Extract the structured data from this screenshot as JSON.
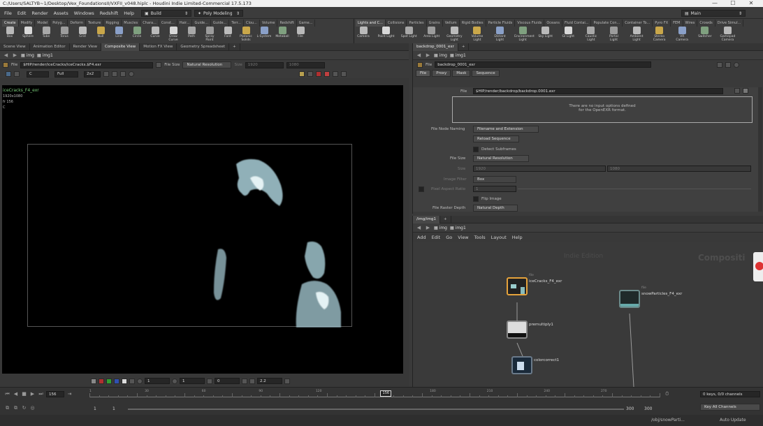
{
  "window": {
    "title": "C:/Users/SALTYB~1/Desktop/Vex_FoundationsII/VXFII_v048.hiplc - Houdini Indie Limited-Commercial 17.5.173",
    "minimize": "—",
    "maximize": "☐",
    "close": "✕"
  },
  "menubar": {
    "items": [
      "File",
      "Edit",
      "Render",
      "Assets",
      "Windows",
      "Redshift",
      "Help"
    ],
    "build_label": "Build",
    "desktop_label": "Poly Modeling",
    "main_label": "Main"
  },
  "shelf_left": {
    "tabs": [
      "Create",
      "Modify",
      "Model",
      "Polyg...",
      "Deform",
      "Texture",
      "Rigging",
      "Muscles",
      "Chara...",
      "Const...",
      "Hair...",
      "Guide...",
      "Guide...",
      "Terr...",
      "Clou...",
      "Volume",
      "Redshift",
      "Game..."
    ],
    "tools": [
      "Box",
      "Sphere",
      "Tube",
      "Torus",
      "Grid",
      "Null",
      "Line",
      "Circle",
      "Curve",
      "Draw Curve",
      "Path",
      "Spray Paint",
      "Font",
      "Platonic Solids",
      "L-System",
      "Metaball",
      "File"
    ]
  },
  "shelf_right": {
    "tabs": [
      "Lights and C...",
      "Collisions",
      "Particles",
      "Grains",
      "Vellum",
      "Rigid Bodies",
      "Particle Fluids",
      "Viscous Fluids",
      "Oceans",
      "Fluid Contai...",
      "Populate Con...",
      "Container To...",
      "Pyro FX",
      "FEM",
      "Wires",
      "Crowds",
      "Drive Simul..."
    ],
    "tools": [
      "Camera",
      "Point Light",
      "Spot Light",
      "Area Light",
      "Geometry Light",
      "Volume Light",
      "Distant Light",
      "Environment Light",
      "Sky Light",
      "GI Light",
      "Caustic Light",
      "Portal Light",
      "Ambient Light",
      "Stereo Camera",
      "VR Camera",
      "Switcher",
      "Gamepad Camera"
    ]
  },
  "left_pane": {
    "tabs": [
      "Scene View",
      "Animation Editor",
      "Render View",
      "Composite View",
      "Motion FX View",
      "Geometry Spreadsheet"
    ],
    "path": [
      "img",
      "img1"
    ],
    "file_label": "File",
    "file_path": "$HIP/render/iceCracks/iceCracks.$F4.exr",
    "filesize_label": "File Size",
    "filesize_value": "Natural Resolution",
    "size_label": "Size",
    "size_w": "1920",
    "size_h": "1080",
    "channel": "C",
    "res": "Full",
    "zoom_ratio": "2x2",
    "overlay_name": "iceCracks_F4_exr",
    "overlay_res": "1920x1080",
    "overlay_frame": "fr 156",
    "overlay_c": "C",
    "bottom_a": "1",
    "bottom_b": "1",
    "bottom_c": "0",
    "gamma": "2.2"
  },
  "param_pane": {
    "tab": "backdrop_0001_exr",
    "path": [
      "img",
      "img1"
    ],
    "node_type": "File",
    "node_name": "backdrop_0001_exr",
    "subtabs": [
      "File",
      "Proxy",
      "Mask",
      "Sequence"
    ],
    "file_label": "File",
    "file_value": "$HIP/render/backdrop/backdrop.0001.exr",
    "info_line1": "There are no input options defined",
    "info_line2": "for the OpenEXR format.",
    "naming_label": "File Node Naming",
    "naming_value": "Filename and Extension",
    "reload_label": "Reload Sequence",
    "subframes_label": "Detect Subframes",
    "filesize_label": "File Size",
    "filesize_value": "Natural Resolution",
    "size_label": "Size",
    "size_w": "1920",
    "size_h": "1080",
    "filter_label": "Image Filter",
    "filter_value": "Box",
    "aspect_label": "Pixel Aspect Ratio",
    "aspect_value": "1",
    "flip_label": "Flip Image",
    "depth_label": "File Raster Depth",
    "depth_value": "Natural Depth"
  },
  "network_pane": {
    "tab": "/img/img1",
    "path": [
      "img",
      "img1"
    ],
    "menu": [
      "Add",
      "Edit",
      "Go",
      "View",
      "Tools",
      "Layout",
      "Help"
    ],
    "watermark1": "Indie Edition",
    "watermark2": "Compositi",
    "nodes": [
      {
        "type": "file",
        "name": "iceCracks_F4_exr"
      },
      {
        "type": "",
        "name": "premultiply1"
      },
      {
        "type": "",
        "name": "colorcorrect1"
      },
      {
        "type": "file",
        "name": "snowParticles_F4_exr"
      }
    ]
  },
  "timeline": {
    "frame": "156",
    "start": "1",
    "start2": "1",
    "end": "300",
    "end2": "300",
    "ticks": [
      "1",
      "30",
      "60",
      "90",
      "120",
      "156",
      "180",
      "210",
      "240",
      "270"
    ],
    "current_fraction": 0.52,
    "keys_label": "0 keys, 0/0 channels",
    "keyall_label": "Key All Channels",
    "status_path": "/obj/snowParti...",
    "autoupdate": "Auto Update"
  },
  "colors": {
    "accent": "#e6a33b",
    "viewer_bg": "#000000",
    "panel": "#3a3a3a"
  }
}
